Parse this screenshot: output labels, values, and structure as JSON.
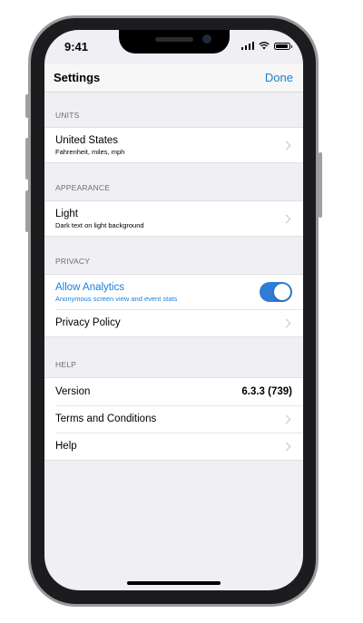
{
  "status_bar": {
    "time": "9:41"
  },
  "nav": {
    "title": "Settings",
    "done_label": "Done"
  },
  "sections": {
    "units": {
      "header": "UNITS",
      "row": {
        "title": "United States",
        "subtitle": "Fahrenheit, miles, mph"
      }
    },
    "appearance": {
      "header": "APPEARANCE",
      "row": {
        "title": "Light",
        "subtitle": "Dark text on light background"
      }
    },
    "privacy": {
      "header": "PRIVACY",
      "analytics": {
        "title": "Allow Analytics",
        "subtitle": "Anonymous screen view and event stats",
        "enabled": true
      },
      "policy": {
        "title": "Privacy Policy"
      }
    },
    "help": {
      "header": "HELP",
      "version": {
        "title": "Version",
        "value": "6.3.3 (739)"
      },
      "terms": {
        "title": "Terms and Conditions"
      },
      "help": {
        "title": "Help"
      }
    }
  },
  "colors": {
    "accent": "#1a7fd6",
    "toggle_on": "#2f7bd6",
    "background": "#efeff4"
  }
}
